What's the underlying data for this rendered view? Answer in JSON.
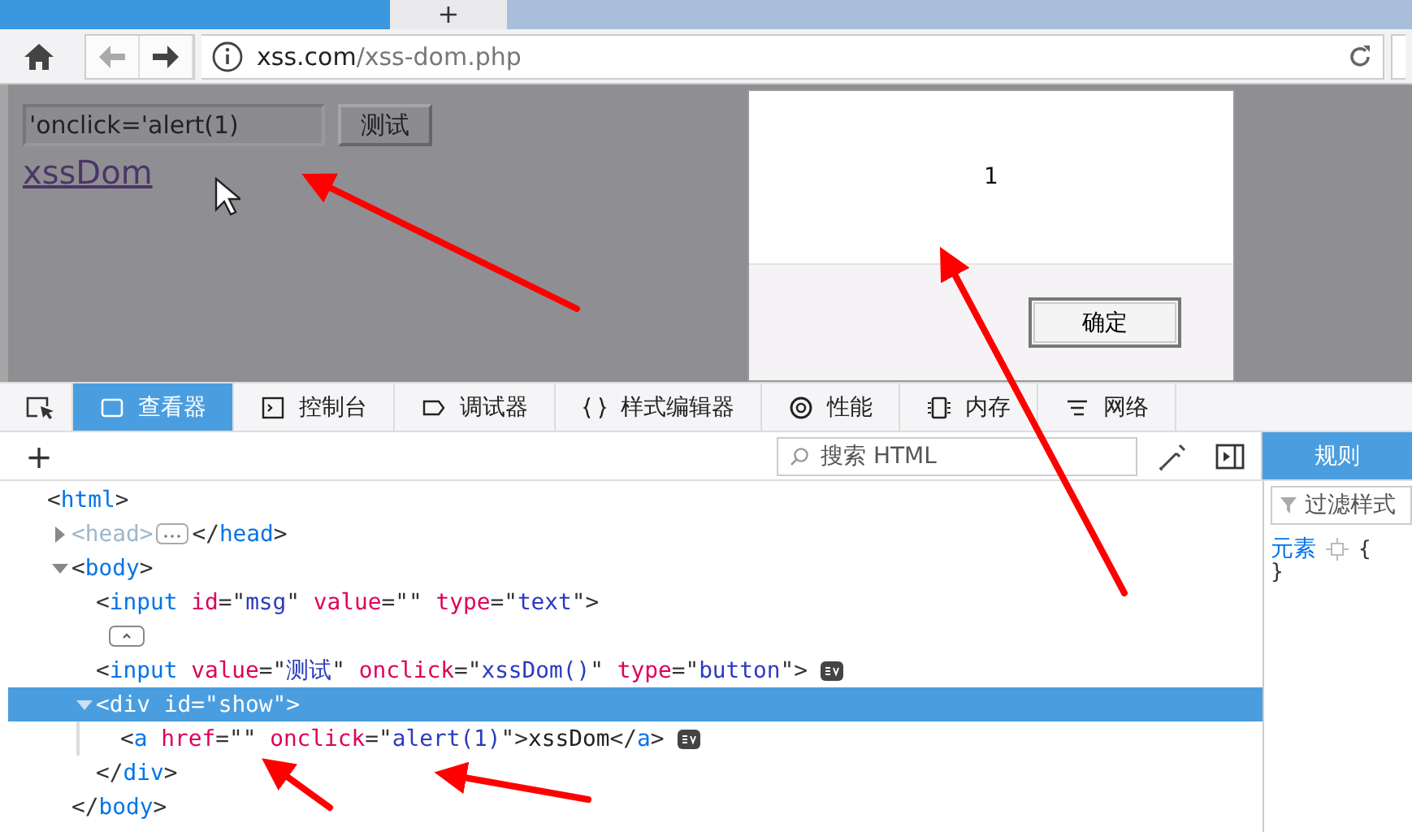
{
  "browser": {
    "new_tab": "+",
    "url_host": "xss.com",
    "url_path": "/xss-dom.php"
  },
  "page": {
    "input_value": "'onclick='alert(1)",
    "button": "测试",
    "link": "xssDom"
  },
  "dialog": {
    "message": "1",
    "ok_button": "确定"
  },
  "devtools": {
    "tabs": [
      {
        "kind": "inspector",
        "label": "查看器",
        "selected": true
      },
      {
        "kind": "console",
        "label": "控制台",
        "selected": false
      },
      {
        "kind": "debugger",
        "label": "调试器",
        "selected": false
      },
      {
        "kind": "style",
        "label": "样式编辑器",
        "selected": false
      },
      {
        "kind": "performance",
        "label": "性能",
        "selected": false
      },
      {
        "kind": "memory",
        "label": "内存",
        "selected": false
      },
      {
        "kind": "network",
        "label": "网络",
        "selected": false
      }
    ],
    "add": "+",
    "search": {
      "placeholder": "搜索 HTML"
    },
    "sidebar": {
      "tab": "规则",
      "filter_placeholder": "过滤样式",
      "rule_selector": "元素",
      "rule_open": "{",
      "rule_close": "}"
    },
    "tree": [
      {
        "open": "<html>",
        "children": [
          {
            "open": "<head>",
            "expanded": false,
            "dimmed": true,
            "close": "</head>"
          },
          {
            "open": "<body>",
            "expanded": true,
            "close": "</body>",
            "children": [
              {
                "open": "<input id=\"msg\" value=\"\" type=\"text\">"
              },
              {
                "kind": "badge"
              },
              {
                "open": "<input value=\"测试\" onclick=\"xssDom()\" type=\"button\">",
                "events": true
              },
              {
                "open": "<div id=\"show\">",
                "expanded": true,
                "selected": true,
                "close": "</div>",
                "children": [
                  {
                    "open": "<a href=\"\" onclick=\"alert(1)\">xssDom</a>",
                    "events": true
                  }
                ]
              }
            ]
          }
        ]
      }
    ]
  }
}
